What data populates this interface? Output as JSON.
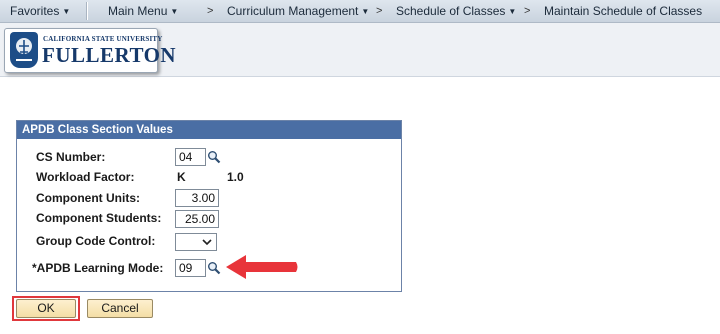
{
  "nav": {
    "favorites": "Favorites",
    "main_menu": "Main Menu",
    "curriculum": "Curriculum Management",
    "schedule": "Schedule of Classes",
    "maintain": "Maintain Schedule of Classes"
  },
  "logo": {
    "university": "CALIFORNIA STATE UNIVERSITY",
    "campus": "FULLERTON"
  },
  "group": {
    "title": "APDB Class Section Values",
    "cs_number_label": "CS Number:",
    "cs_number_value": "04",
    "workload_label": "Workload Factor:",
    "workload_code": "K",
    "workload_value": "1.0",
    "units_label": "Component Units:",
    "units_value": "3.00",
    "students_label": "Component Students:",
    "students_value": "25.00",
    "group_code_label": "Group Code Control:",
    "group_code_value": "",
    "learning_mode_label": "*APDB Learning Mode:",
    "learning_mode_value": "09"
  },
  "buttons": {
    "ok": "OK",
    "cancel": "Cancel"
  },
  "colors": {
    "group_header": "#4a6ea4",
    "highlight": "#e0383c",
    "button": "#f4dea6"
  },
  "icons": [
    "lookup-icon",
    "chevron-down-icon",
    "callout-arrow-icon"
  ]
}
